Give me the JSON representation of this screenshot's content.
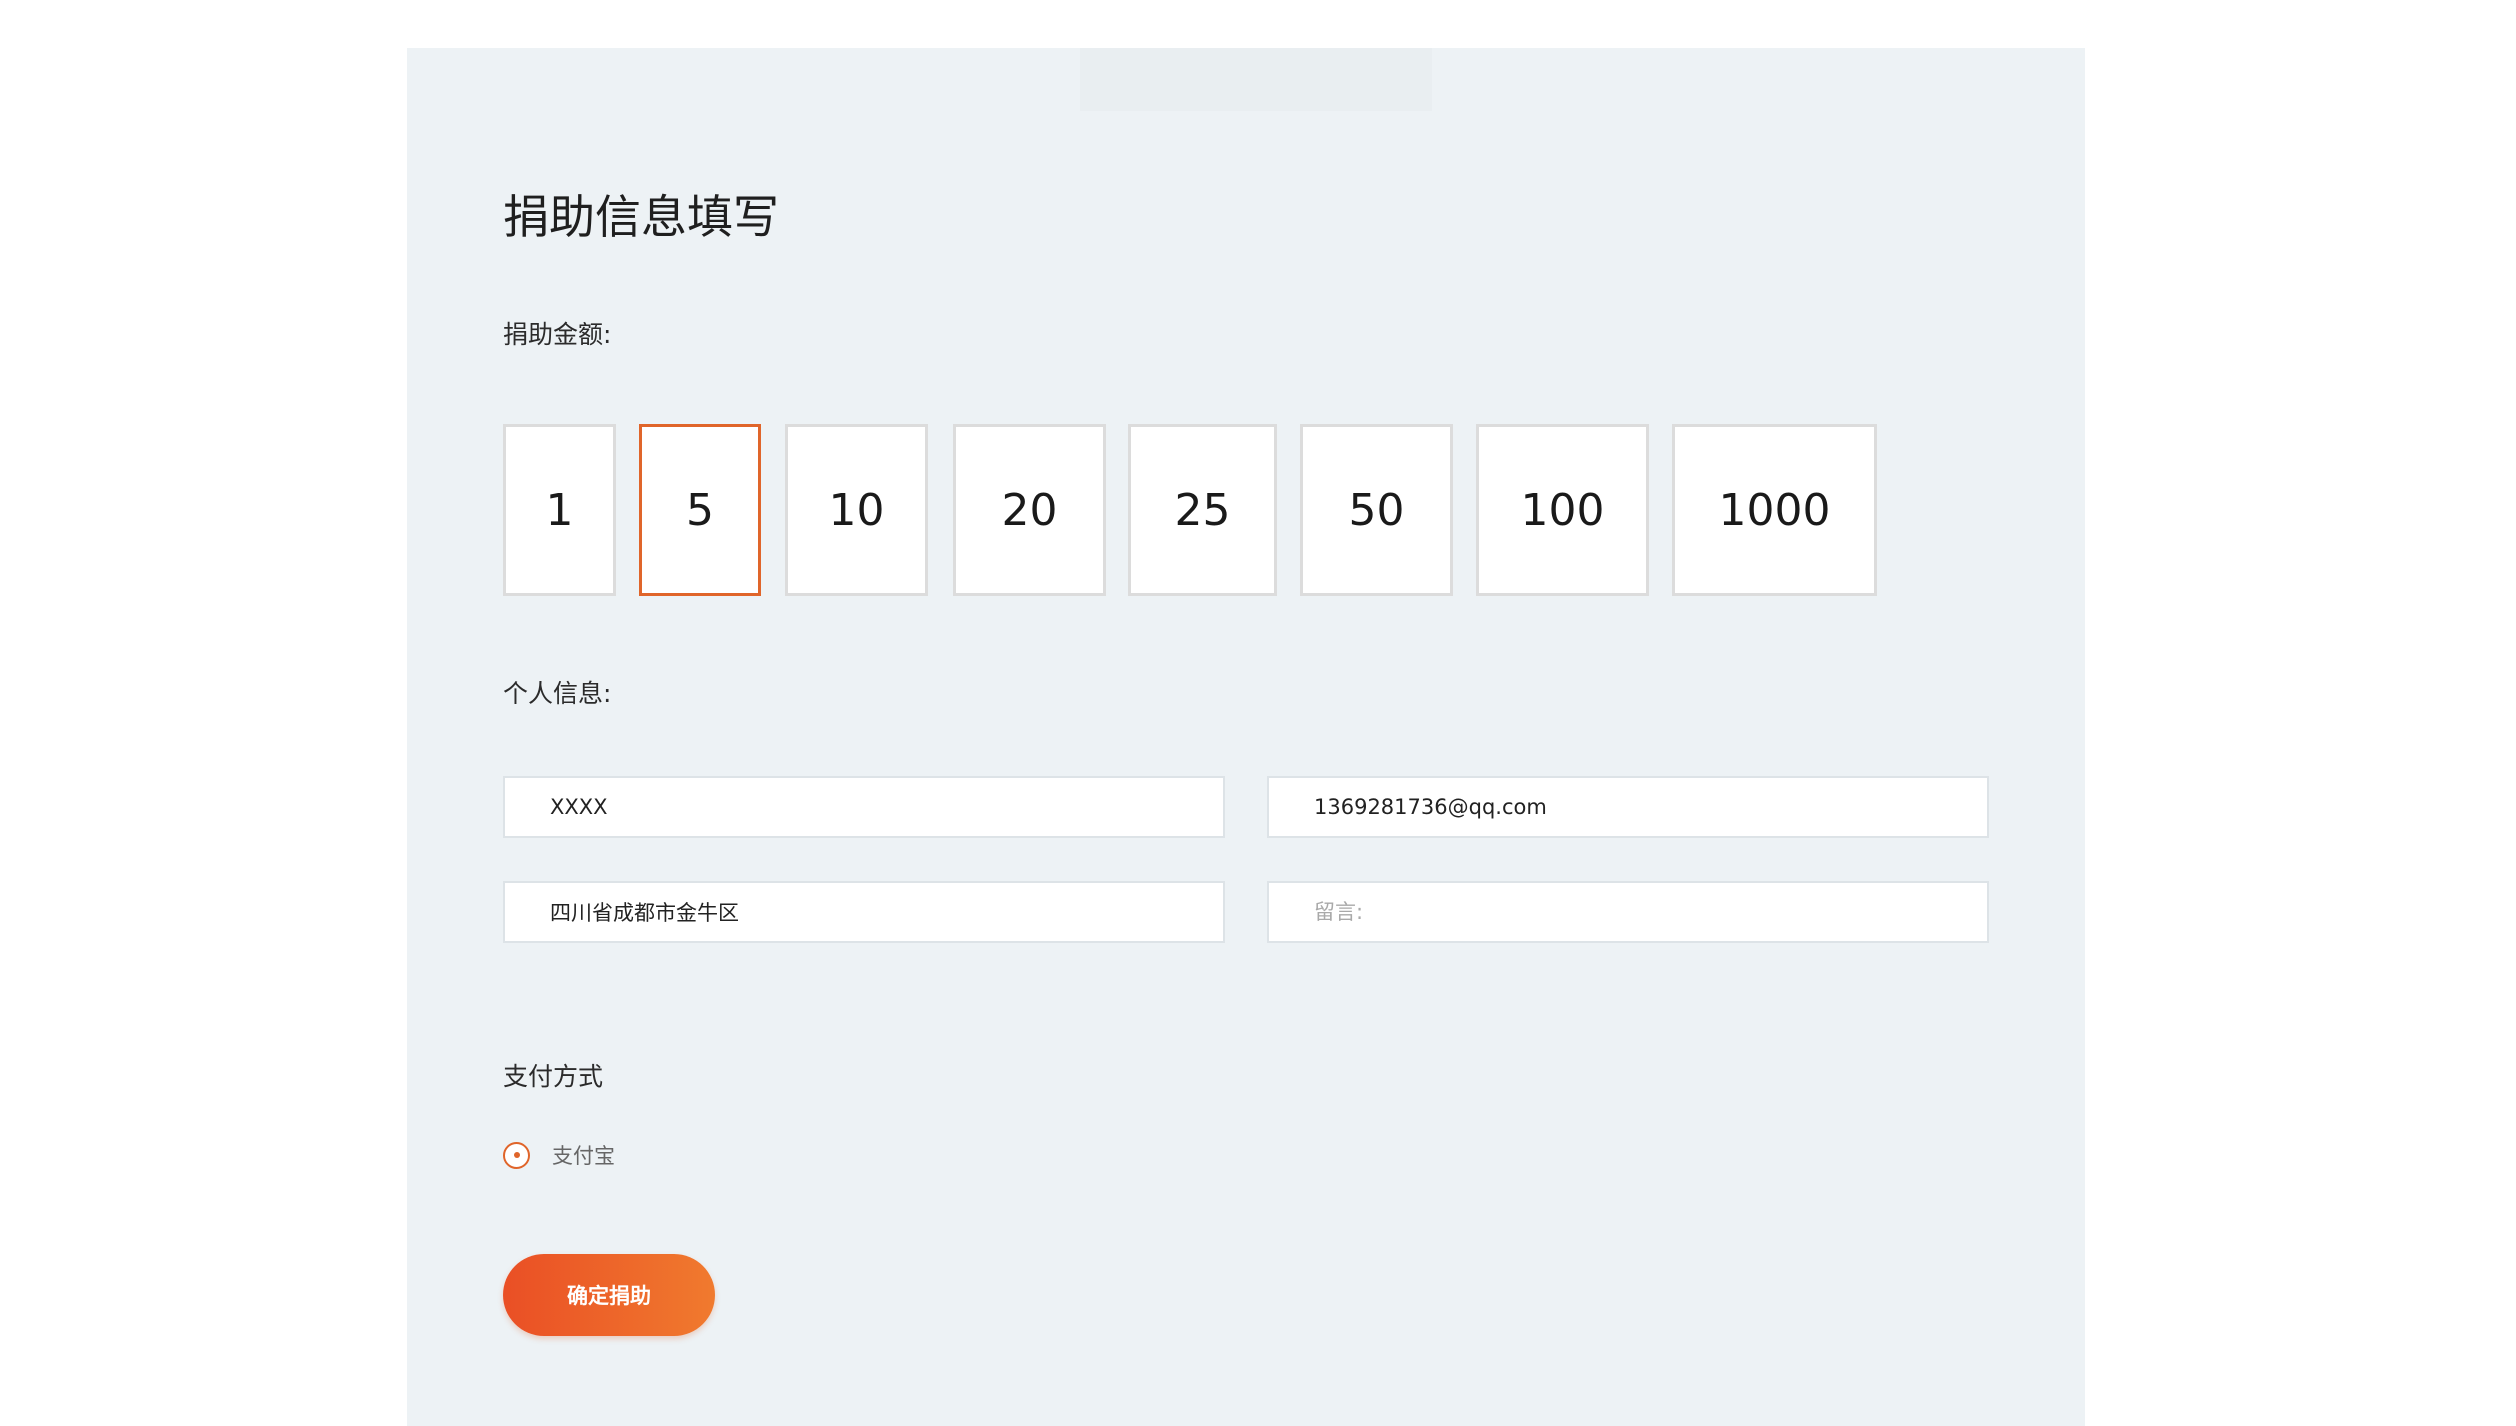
{
  "form": {
    "title": "捐助信息填写",
    "amount_label": "捐助金额:",
    "amounts": [
      "1",
      "5",
      "10",
      "20",
      "25",
      "50",
      "100",
      "1000"
    ],
    "selected_amount": "5",
    "personal_label": "个人信息:",
    "fields": {
      "name": {
        "value": "XXXX"
      },
      "email": {
        "value": "1369281736@qq.com"
      },
      "address": {
        "value": "四川省成都市金牛区"
      },
      "message": {
        "placeholder": "留言:"
      }
    },
    "payment_label": "支付方式",
    "payment_option": "支付宝",
    "submit_label": "确定捐助"
  },
  "colors": {
    "accent": "#e0652a",
    "panel_background": "#edf2f5",
    "button_gradient_start": "#ea4f25",
    "button_gradient_end": "#f07a2e"
  },
  "icons": {
    "payment_radio": "radio-selected-icon"
  }
}
